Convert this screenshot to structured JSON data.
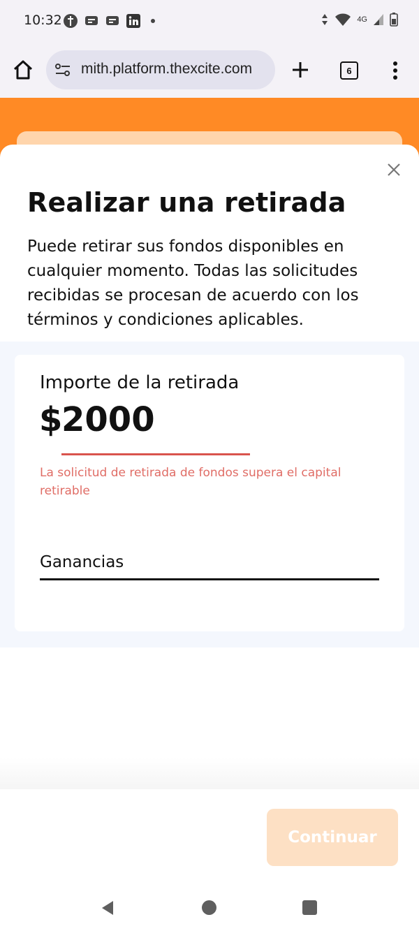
{
  "status_bar": {
    "time": "10:32",
    "network_label": "4G"
  },
  "browser": {
    "url": "mith.platform.thexcite.com",
    "tab_count": "6"
  },
  "modal": {
    "title": "Realizar una retirada",
    "description": "Puede retirar sus fondos disponibles en cualquier momento. Todas las solicitudes recibidas se procesan de acuerdo con los términos y condiciones aplicables.",
    "amount_label": "Importe de la retirada",
    "currency_symbol": "$",
    "amount_value": "2000",
    "amount_error": "La solicitud de retirada de fondos supera el capital retirable",
    "source_value": "Ganancias",
    "continue_label": "Continuar"
  },
  "colors": {
    "brand_orange": "#ff8a25",
    "error_red": "#d9544d",
    "disabled_button": "#fde0c4"
  }
}
